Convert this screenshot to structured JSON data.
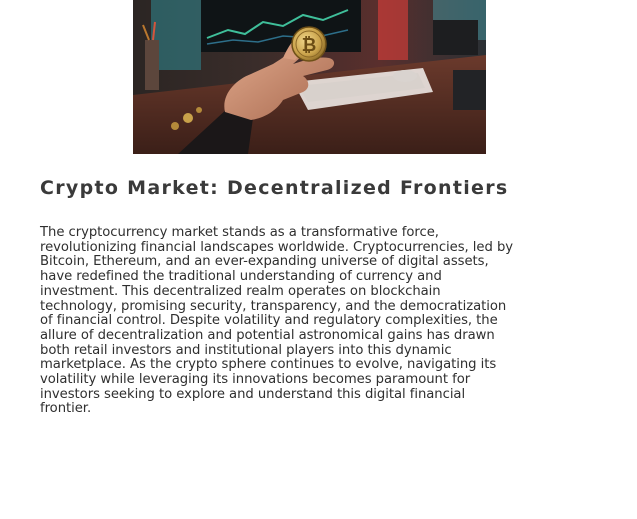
{
  "article": {
    "image_alt": "Hand holding a bitcoin coin in front of a computer desk",
    "title": "Crypto Market: Decentralized Frontiers",
    "body_lines": [
      "The cryptocurrency market stands as a transformative force,",
      "revolutionizing financial landscapes worldwide. Cryptocurrencies, led by",
      "Bitcoin, Ethereum, and an ever-expanding universe of digital assets,",
      "have redefined the traditional understanding of currency and",
      "investment. This decentralized realm operates on blockchain",
      "technology, promising security, transparency, and the democratization",
      "of financial control. Despite volatility and regulatory complexities, the",
      "allure of decentralization and potential astronomical gains has drawn",
      "both retail investors and institutional players into this dynamic",
      "marketplace. As the crypto sphere continues to evolve, navigating its",
      "volatility while leveraging its innovations becomes paramount for",
      "investors seeking to explore and understand this digital financial",
      "frontier."
    ]
  },
  "colors": {
    "title": "#3a3a3a",
    "body_text": "#2f2f2f",
    "background": "#ffffff",
    "coin": "#c9a24a"
  }
}
